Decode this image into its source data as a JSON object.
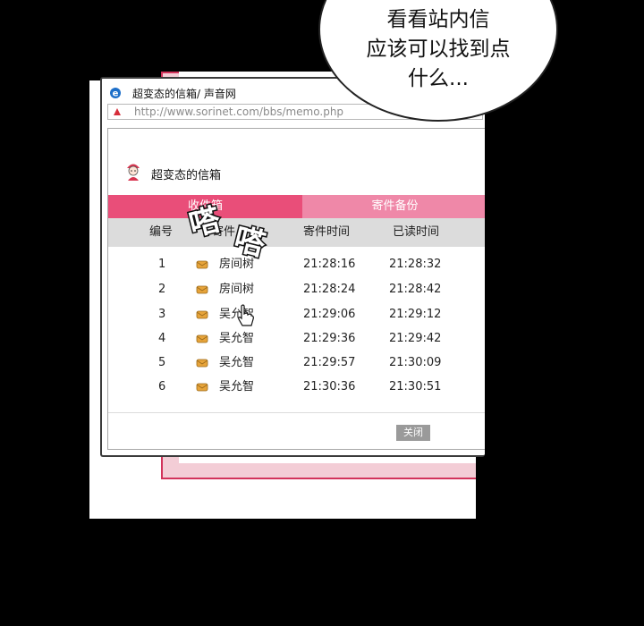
{
  "browser": {
    "window_title": "超变态的信箱/ 声音网",
    "url": "http://www.sorinet.com/bbs/memo.php"
  },
  "mailbox": {
    "title": "超变态的信箱",
    "tabs": [
      {
        "label": "收件箱",
        "active": true
      },
      {
        "label": "寄件备份",
        "active": false
      }
    ],
    "columns": [
      "编号",
      "寄件人",
      "寄件时间",
      "已读时间"
    ],
    "rows": [
      {
        "no": "1",
        "sender": "房间树",
        "sent": "21:28:16",
        "read": "21:28:32"
      },
      {
        "no": "2",
        "sender": "房间树",
        "sent": "21:28:24",
        "read": "21:28:42"
      },
      {
        "no": "3",
        "sender": "吴允智",
        "sent": "21:29:06",
        "read": "21:29:12"
      },
      {
        "no": "4",
        "sender": "吴允智",
        "sent": "21:29:36",
        "read": "21:29:42"
      },
      {
        "no": "5",
        "sender": "吴允智",
        "sent": "21:29:57",
        "read": "21:30:09"
      },
      {
        "no": "6",
        "sender": "吴允智",
        "sent": "21:30:36",
        "read": "21:30:51"
      }
    ],
    "close_label": "关闭"
  },
  "overlay": {
    "sound_effect": [
      "嗒",
      "嗒"
    ],
    "speech_bubble": [
      "看看站内信",
      "应该可以找到点",
      "什么..."
    ]
  },
  "colors": {
    "tab_active": "#e94e79",
    "tab_inactive": "#ef88a8",
    "frame_accent": "#d2335b"
  }
}
